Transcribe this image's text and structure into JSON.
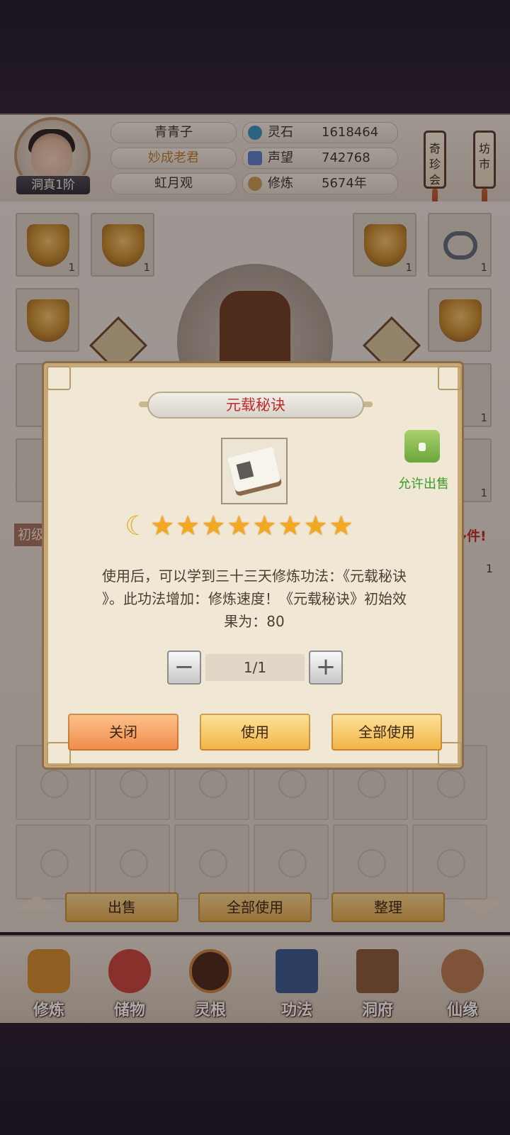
{
  "player": {
    "name": "青青子",
    "title": "妙成老君",
    "sect": "虹月观",
    "rank": "洞真1阶"
  },
  "resources": [
    {
      "label": "灵石",
      "value": "1618464",
      "icon": "spirit-stone-icon",
      "color": "#3a93b7"
    },
    {
      "label": "声望",
      "value": "742768",
      "icon": "reputation-icon",
      "color": "#5d7fc6"
    },
    {
      "label": "修炼",
      "value": "5674年",
      "icon": "meditation-icon",
      "color": "#c99a4a"
    }
  ],
  "side_tags": {
    "treasure_fair": "奇珍会",
    "market": "坊市"
  },
  "inventory": {
    "left_slots": [
      {
        "qty": "1"
      },
      {
        "qty": "1"
      },
      {
        "qty": ""
      },
      {
        "qty": ""
      }
    ],
    "right_slots": [
      {
        "qty": "1"
      },
      {
        "qty": "1"
      },
      {
        "qty": ""
      },
      {
        "qty": "1"
      },
      {
        "qty": "1"
      }
    ],
    "bag_header_left": "初级",
    "bag_header_right": "多件!",
    "side_qty": "1"
  },
  "bottom_buttons": {
    "sell": "出售",
    "use_all": "全部使用",
    "sort": "整理"
  },
  "dialog": {
    "title": "元载秘诀",
    "allow_sell": "允许出售",
    "stars": 8,
    "description_lines": [
      "使用后，可以学到三十三天修炼功法：《元载秘诀",
      "》。此功法增加：修炼速度！《元载秘诀》初始效",
      "果为：80"
    ],
    "quantity": "1/1",
    "minus": "−",
    "plus": "+",
    "buttons": {
      "close": "关闭",
      "use": "使用",
      "use_all": "全部使用"
    }
  },
  "nav": [
    {
      "label": "修炼",
      "icon": "cultivation-icon",
      "color": "#d58a2a"
    },
    {
      "label": "储物",
      "icon": "storage-bag-icon",
      "color": "#c8433a"
    },
    {
      "label": "灵根",
      "icon": "spirit-root-icon",
      "color": "#4a2a1a"
    },
    {
      "label": "功法",
      "icon": "technique-book-icon",
      "color": "#3a5a8a"
    },
    {
      "label": "洞府",
      "icon": "cave-dwelling-icon",
      "color": "#8a5a3a"
    },
    {
      "label": "仙缘",
      "icon": "immortal-fate-icon",
      "color": "#b87a4a"
    }
  ]
}
